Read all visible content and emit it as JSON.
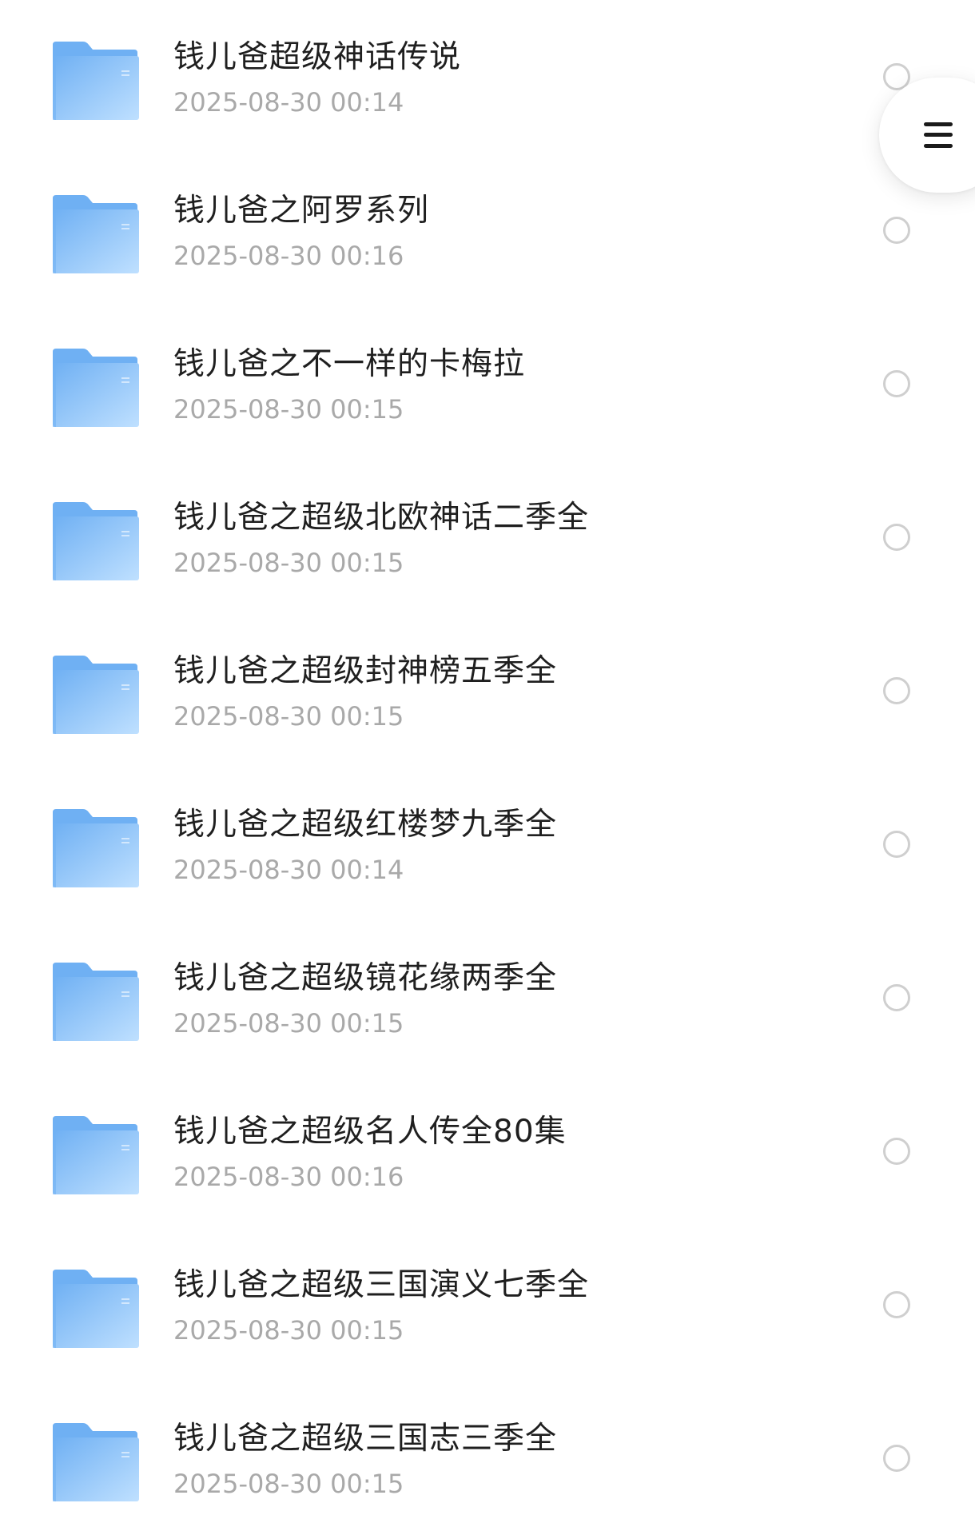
{
  "files": [
    {
      "name": "钱儿爸超级神话传说",
      "date": "2025-08-30 00:14"
    },
    {
      "name": "钱儿爸之阿罗系列",
      "date": "2025-08-30 00:16"
    },
    {
      "name": "钱儿爸之不一样的卡梅拉",
      "date": "2025-08-30 00:15"
    },
    {
      "name": "钱儿爸之超级北欧神话二季全",
      "date": "2025-08-30 00:15"
    },
    {
      "name": "钱儿爸之超级封神榜五季全",
      "date": "2025-08-30 00:15"
    },
    {
      "name": "钱儿爸之超级红楼梦九季全",
      "date": "2025-08-30 00:14"
    },
    {
      "name": "钱儿爸之超级镜花缘两季全",
      "date": "2025-08-30 00:15"
    },
    {
      "name": "钱儿爸之超级名人传全80集",
      "date": "2025-08-30 00:16"
    },
    {
      "name": "钱儿爸之超级三国演义七季全",
      "date": "2025-08-30 00:15"
    },
    {
      "name": "钱儿爸之超级三国志三季全",
      "date": "2025-08-30 00:15"
    }
  ],
  "icons": {
    "file": "folder-icon",
    "select": "radio-circle-icon",
    "menu": "hamburger-menu-icon"
  },
  "colors": {
    "folder_light": "#bfe0ff",
    "folder_dark": "#6fb0f3",
    "name_text": "#1f1f1f",
    "date_text": "#a9a9a9",
    "circle_border": "#cfcfcf"
  }
}
